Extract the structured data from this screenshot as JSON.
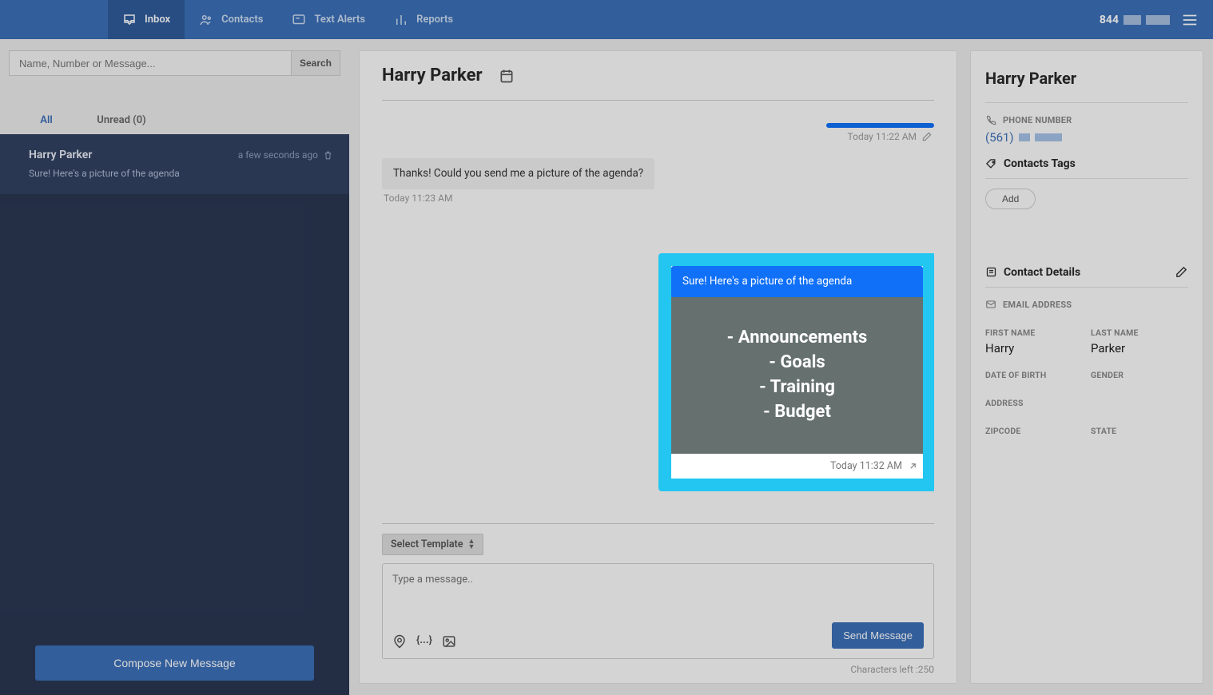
{
  "topnav": {
    "items": [
      {
        "label": "Inbox",
        "active": true
      },
      {
        "label": "Contacts",
        "active": false
      },
      {
        "label": "Text Alerts",
        "active": false
      },
      {
        "label": "Reports",
        "active": false
      }
    ],
    "account_number": "844"
  },
  "search": {
    "placeholder": "Name, Number or Message...",
    "button": "Search"
  },
  "filter_tabs": {
    "all": "All",
    "unread": "Unread (0)"
  },
  "conversations": [
    {
      "name": "Harry Parker",
      "timeago": "a few seconds ago",
      "preview": "Sure! Here's a picture of the agenda"
    }
  ],
  "compose_button": "Compose New Message",
  "chat": {
    "title": "Harry Parker",
    "messages": {
      "m1_time": "Today 11:22 AM",
      "m2_text": "Thanks! Could you send me a picture of the agenda?",
      "m2_time": "Today 11:23 AM",
      "m3_text": "Sure! Here's a picture of the agenda",
      "m3_time": "Today 11:32 AM",
      "agenda_lines": [
        "- Announcements",
        "- Goals",
        "- Training",
        "- Budget"
      ]
    },
    "template_select": "Select Template",
    "composer_placeholder": "Type a message..",
    "send_button": "Send Message",
    "characters_left": "Characters left :250"
  },
  "details": {
    "name": "Harry Parker",
    "phone_label": "PHONE NUMBER",
    "phone_prefix": "(561)",
    "tags_title": "Contacts Tags",
    "add_button": "Add",
    "details_title": "Contact Details",
    "email_label": "EMAIL ADDRESS",
    "fields": {
      "first_name_label": "FIRST NAME",
      "first_name": "Harry",
      "last_name_label": "LAST NAME",
      "last_name": "Parker",
      "dob_label": "DATE OF BIRTH",
      "gender_label": "GENDER",
      "address_label": "ADDRESS",
      "zipcode_label": "ZIPCODE",
      "state_label": "STATE"
    }
  }
}
